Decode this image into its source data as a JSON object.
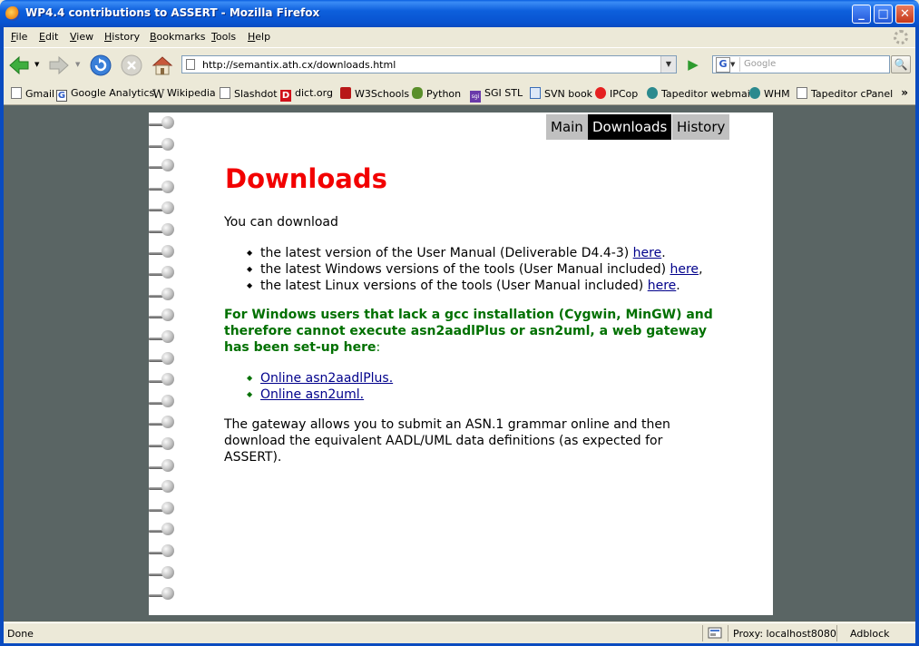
{
  "window": {
    "title": "WP4.4 contributions to ASSERT - Mozilla Firefox",
    "minimize": "_",
    "maximize": "□",
    "close": "✕"
  },
  "menu": {
    "items": [
      {
        "accel": "F",
        "rest": "ile"
      },
      {
        "accel": "E",
        "rest": "dit"
      },
      {
        "accel": "V",
        "rest": "iew"
      },
      {
        "accel": "H",
        "rest": "istory"
      },
      {
        "accel": "B",
        "rest": "ookmarks"
      },
      {
        "accel": "T",
        "rest": "ools"
      },
      {
        "accel": "H",
        "rest": "elp"
      }
    ]
  },
  "nav": {
    "url": "http://semantix.ath.cx/downloads.html",
    "search_placeholder": "Google",
    "search_engine_letter": "G"
  },
  "bookmarks": [
    {
      "label": "Gmail",
      "icon": "page"
    },
    {
      "label": "Google Analytics",
      "icon": "google-icon"
    },
    {
      "label": "Wikipedia",
      "icon": "wikipedia-icon"
    },
    {
      "label": "Slashdot",
      "icon": "page"
    },
    {
      "label": "dict.org",
      "icon": "dict-icon"
    },
    {
      "label": "W3Schools",
      "icon": "w3schools-icon"
    },
    {
      "label": "Python",
      "icon": "python-icon"
    },
    {
      "label": "SGI STL",
      "icon": "sgi-icon"
    },
    {
      "label": "SVN book",
      "icon": "svn-icon"
    },
    {
      "label": "IPCop",
      "icon": "ipcop-icon"
    },
    {
      "label": "Tapeditor webmail",
      "icon": "tapeditor-icon"
    },
    {
      "label": "WHM",
      "icon": "tapeditor-icon"
    },
    {
      "label": "Tapeditor cPanel",
      "icon": "page"
    }
  ],
  "bookmarks_more": "»",
  "page": {
    "tabs": [
      "Main",
      "Downloads",
      "History"
    ],
    "active_tab": "Downloads",
    "heading": "Downloads",
    "intro": "You can download",
    "downloads": [
      {
        "text": "the latest version of the User Manual (Deliverable D4.4-3) ",
        "link": "here",
        "after": "."
      },
      {
        "text": "the latest Windows versions of the tools (User Manual included) ",
        "link": "here",
        "after": ","
      },
      {
        "text": "the latest Linux versions of the tools (User Manual included) ",
        "link": "here",
        "after": "."
      }
    ],
    "gateway_note_lines": [
      "For Windows users that lack a gcc installation (Cygwin, MinGW) and",
      "therefore cannot execute asn2aadlPlus or asn2uml, a web gateway",
      "has been set-up here"
    ],
    "gateway_note_tail": ":",
    "gateway_links": [
      "Online asn2aadlPlus.",
      "Online asn2uml."
    ],
    "closing_lines": [
      "The gateway allows you to submit an ASN.1 grammar online and then",
      "download the equivalent AADL/UML data definitions (as expected for",
      "ASSERT)."
    ]
  },
  "status": {
    "text": "Done",
    "proxy": "Proxy: localhost8080",
    "adblock": "Adblock"
  },
  "colors": {
    "heading": "#f20000",
    "note": "#007000",
    "link": "#00008b",
    "background": "#5a6564"
  }
}
